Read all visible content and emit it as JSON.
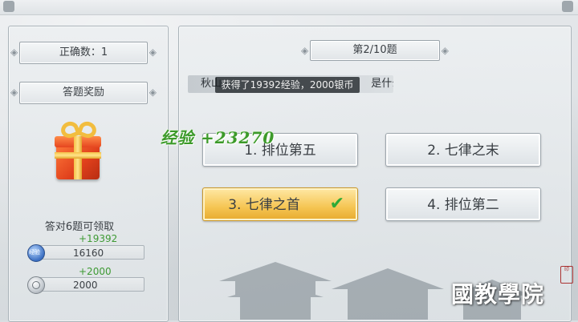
{
  "left": {
    "correct_count_label": "正确数：1",
    "reward_title": "答题奖励",
    "reward_condition": "答对6题可领取",
    "exp": {
      "bonus": "+19392",
      "value": "16160",
      "icon": "exp-icon"
    },
    "silver": {
      "bonus": "+2000",
      "value": "2000",
      "icon": "silver-coin-icon"
    }
  },
  "quiz": {
    "progress": "第2/10题",
    "question_visible_start": "秋山",
    "question_visible_end": "是什么？",
    "toast": "获得了19392经验，2000银币",
    "options": [
      {
        "label": "1. 排位第五",
        "selected": false
      },
      {
        "label": "2. 七律之末",
        "selected": false
      },
      {
        "label": "3. 七律之首",
        "selected": true
      },
      {
        "label": "4. 排位第二",
        "selected": false
      }
    ],
    "check_icon": "check-icon"
  },
  "exp_popup": "经验 +23270",
  "watermark": "國教學院",
  "colors": {
    "selected_option": "#f5c552",
    "bonus_text": "#3e9a34",
    "check": "#2eaa37"
  }
}
